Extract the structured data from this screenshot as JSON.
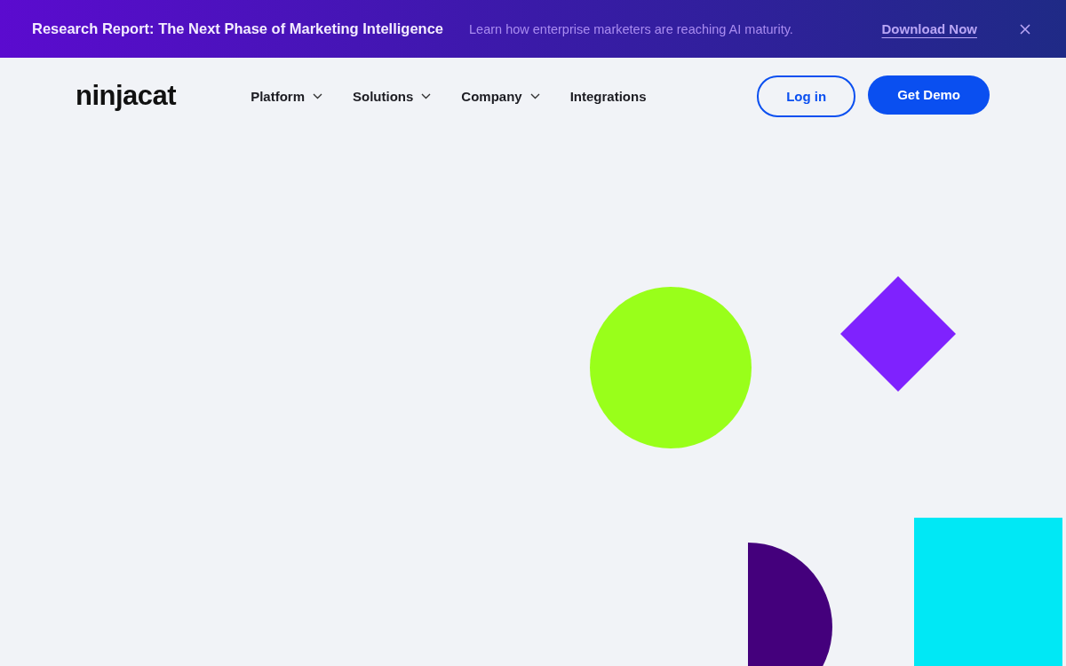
{
  "banner": {
    "title": "Research Report: The Next Phase of Marketing Intelligence",
    "text": "Learn how enterprise marketers are reaching AI maturity.",
    "link": "Download Now"
  },
  "logo": "ninjacat",
  "nav": [
    {
      "label": "Platform",
      "kind": "dropdown"
    },
    {
      "label": "Solutions",
      "kind": "dropdown"
    },
    {
      "label": "Company",
      "kind": "dropdown"
    },
    {
      "label": "Integrations",
      "kind": "link"
    }
  ],
  "buttons": [
    {
      "label": "Log in",
      "kind": "outline"
    },
    {
      "label": "Get Demo",
      "kind": "filled"
    }
  ]
}
